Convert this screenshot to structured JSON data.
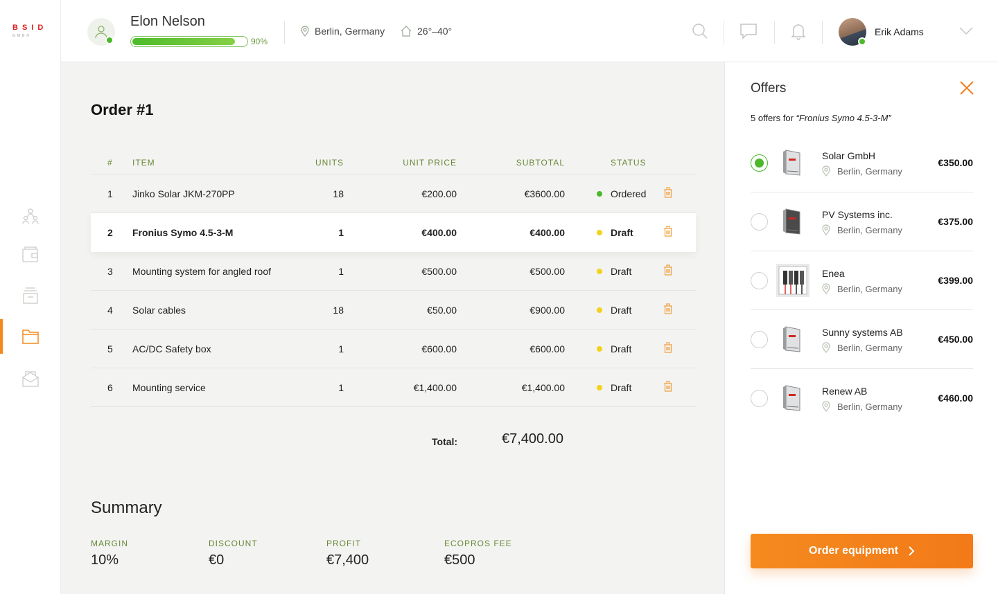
{
  "brand": {
    "name": "BSID",
    "sub": "GMBH",
    "color": "#d81f1f"
  },
  "sidebar": {
    "items": [
      {
        "icon": "people-icon",
        "active": false
      },
      {
        "icon": "wallet-icon",
        "active": false
      },
      {
        "icon": "archive-icon",
        "active": false
      },
      {
        "icon": "folder-icon",
        "active": true
      },
      {
        "icon": "mail-icon",
        "active": false
      }
    ]
  },
  "header": {
    "client_name": "Elon Nelson",
    "progress_percent": 90,
    "progress_label": "90%",
    "location": "Berlin, Germany",
    "temperature": "26°–40°",
    "user_name": "Erik Adams"
  },
  "order": {
    "title": "Order #1",
    "columns": {
      "num": "#",
      "item": "ITEM",
      "units": "UNITS",
      "unit_price": "UNIT PRICE",
      "subtotal": "SUBTOTAL",
      "status": "STATUS"
    },
    "rows": [
      {
        "num": "1",
        "item": "Jinko Solar JKM-270PP",
        "units": "18",
        "unit_price": "€200.00",
        "subtotal": "€3600.00",
        "status": "Ordered",
        "status_color": "#4cb82c"
      },
      {
        "num": "2",
        "item": "Fronius Symo 4.5-3-M",
        "units": "1",
        "unit_price": "€400.00",
        "subtotal": "€400.00",
        "status": "Draft",
        "status_color": "#f2d21b"
      },
      {
        "num": "3",
        "item": "Mounting system for angled roof",
        "units": "1",
        "unit_price": "€500.00",
        "subtotal": "€500.00",
        "status": "Draft",
        "status_color": "#f2d21b"
      },
      {
        "num": "4",
        "item": "Solar cables",
        "units": "18",
        "unit_price": "€50.00",
        "subtotal": "€900.00",
        "status": "Draft",
        "status_color": "#f2d21b"
      },
      {
        "num": "5",
        "item": "AC/DC Safety box",
        "units": "1",
        "unit_price": "€600.00",
        "subtotal": "€600.00",
        "status": "Draft",
        "status_color": "#f2d21b"
      },
      {
        "num": "6",
        "item": "Mounting service",
        "units": "1",
        "unit_price": "€1,400.00",
        "subtotal": "€1,400.00",
        "status": "Draft",
        "status_color": "#f2d21b"
      }
    ],
    "total_label": "Total:",
    "total_value": "€7,400.00"
  },
  "summary": {
    "title": "Summary",
    "items": [
      {
        "label": "MARGIN",
        "value": "10%"
      },
      {
        "label": "DISCOUNT",
        "value": "€0"
      },
      {
        "label": "PROFIT",
        "value": "€7,400"
      },
      {
        "label": "ECOPROS FEE",
        "value": "€500"
      }
    ]
  },
  "offers": {
    "title": "Offers",
    "subtitle_prefix": "5 offers for ",
    "subtitle_product": "“Fronius Symo 4.5-3-M”",
    "items": [
      {
        "name": "Solar GmbH",
        "location": "Berlin, Germany",
        "price": "€350.00",
        "selected": true,
        "thumb": "inverter"
      },
      {
        "name": "PV Systems inc.",
        "location": "Berlin, Germany",
        "price": "€375.00",
        "selected": false,
        "thumb": "inverter-dark"
      },
      {
        "name": "Enea",
        "location": "Berlin, Germany",
        "price": "€399.00",
        "selected": false,
        "thumb": "breaker-box"
      },
      {
        "name": "Sunny systems AB",
        "location": "Berlin, Germany",
        "price": "€450.00",
        "selected": false,
        "thumb": "inverter"
      },
      {
        "name": "Renew AB",
        "location": "Berlin, Germany",
        "price": "€460.00",
        "selected": false,
        "thumb": "inverter"
      }
    ],
    "order_button": "Order equipment"
  },
  "colors": {
    "accent": "#f27a18",
    "green": "#4cb82c",
    "draft": "#f2d21b"
  }
}
